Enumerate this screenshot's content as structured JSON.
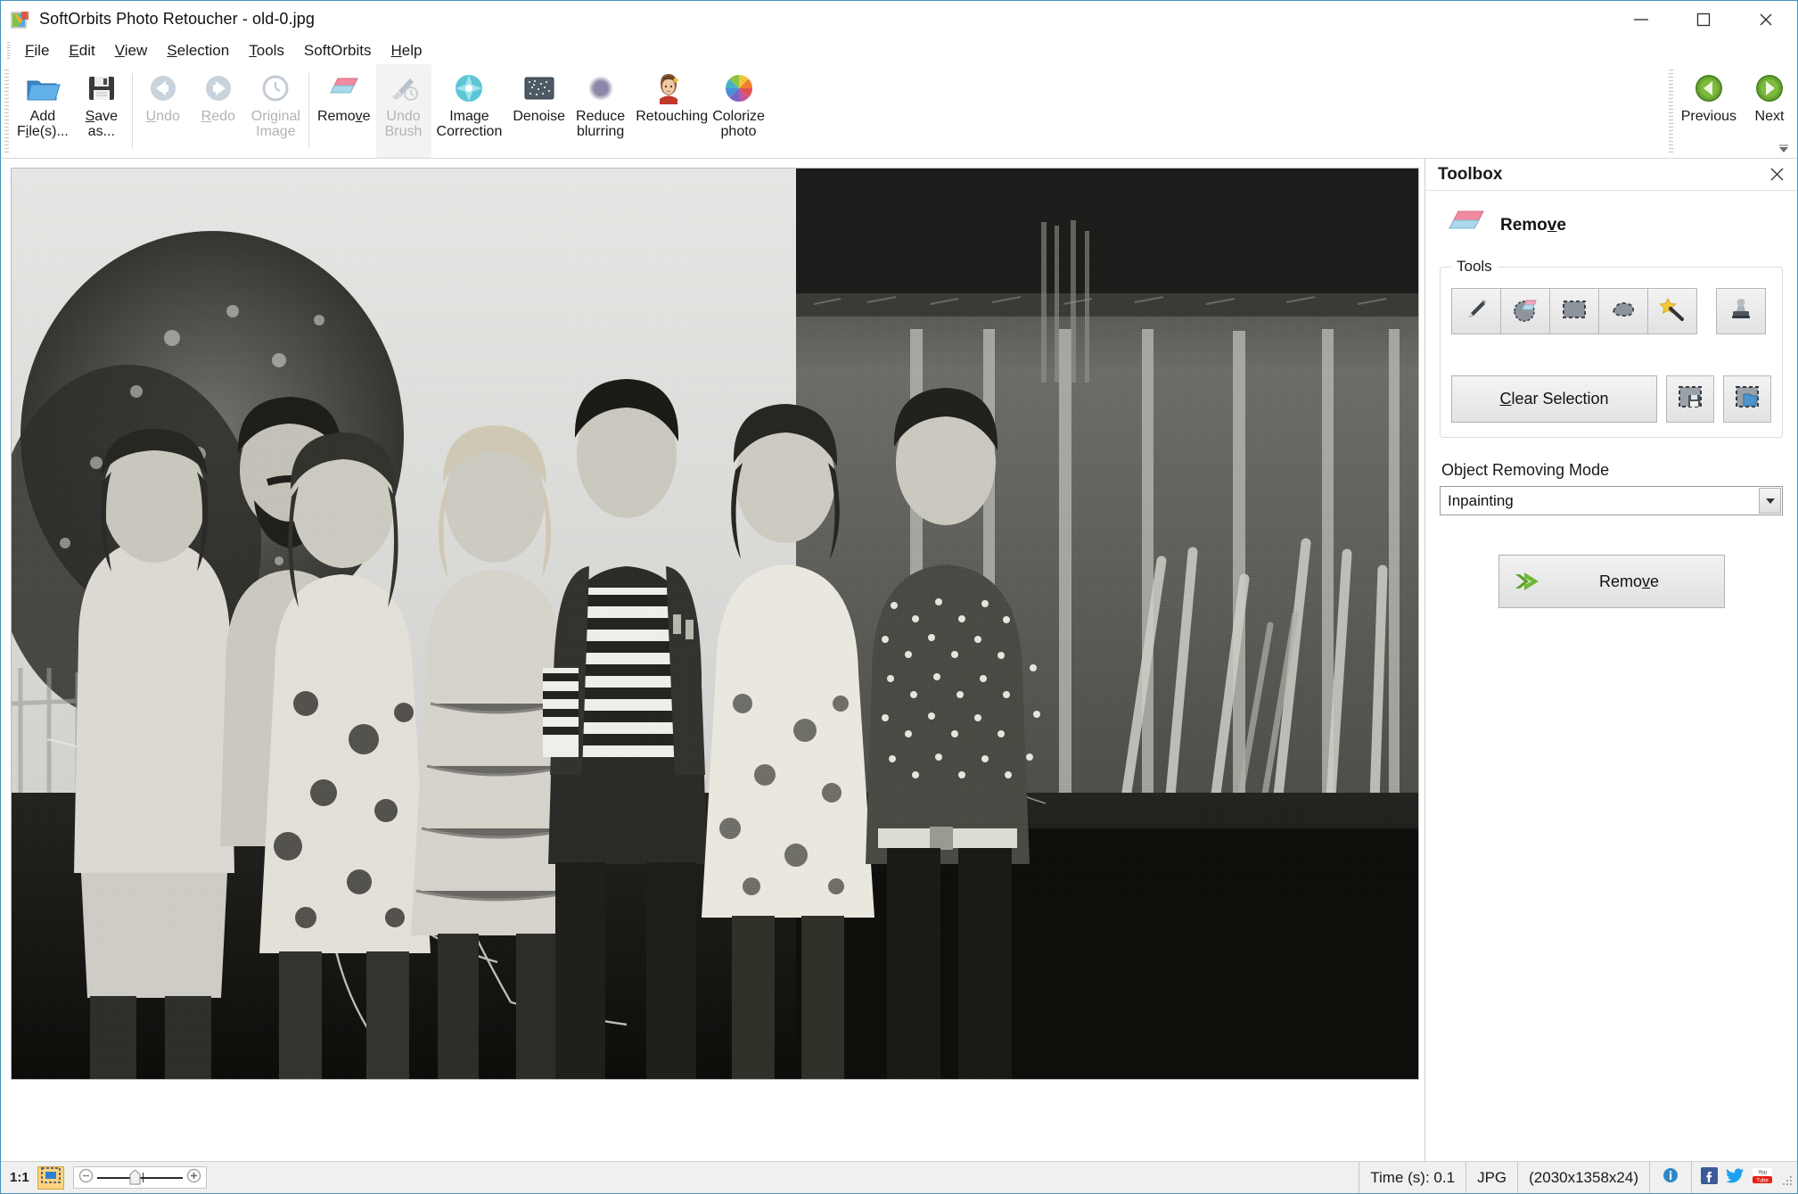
{
  "window": {
    "title": "SoftOrbits Photo Retoucher - old-0.jpg",
    "app_icon": "app-logo-icon",
    "minimize_label": "Minimize",
    "maximize_label": "Maximize",
    "close_label": "Close"
  },
  "menu": {
    "items": [
      {
        "label": "File",
        "accel": "F"
      },
      {
        "label": "Edit",
        "accel": "E"
      },
      {
        "label": "View",
        "accel": "V"
      },
      {
        "label": "Selection",
        "accel": "S"
      },
      {
        "label": "Tools",
        "accel": "T"
      },
      {
        "label": "SoftOrbits",
        "accel": ""
      },
      {
        "label": "Help",
        "accel": "H"
      }
    ]
  },
  "ribbon": {
    "buttons": [
      {
        "id": "add-files",
        "line1": "Add",
        "line2": "File(s)...",
        "icon": "open-folder-icon",
        "enabled": true,
        "accel": "F"
      },
      {
        "id": "save-as",
        "line1": "Save",
        "line2": "as...",
        "icon": "floppy-disk-icon",
        "enabled": true,
        "accel": "S"
      },
      {
        "id": "undo",
        "line1": "Undo",
        "line2": "",
        "icon": "arrow-left-circle-icon",
        "enabled": false,
        "accel": "U"
      },
      {
        "id": "redo",
        "line1": "Redo",
        "line2": "",
        "icon": "arrow-right-circle-icon",
        "enabled": false,
        "accel": "R"
      },
      {
        "id": "original-image",
        "line1": "Original",
        "line2": "Image",
        "icon": "clock-history-icon",
        "enabled": false,
        "accel": ""
      },
      {
        "id": "remove",
        "line1": "Remove",
        "line2": "",
        "icon": "eraser-icon",
        "enabled": true,
        "accel": "v"
      },
      {
        "id": "undo-brush",
        "line1": "Undo",
        "line2": "Brush",
        "icon": "brush-clock-icon",
        "enabled": false,
        "accel": ""
      },
      {
        "id": "image-correction",
        "line1": "Image",
        "line2": "Correction",
        "icon": "sparkle-star-icon",
        "enabled": true,
        "accel": ""
      },
      {
        "id": "denoise",
        "line1": "Denoise",
        "line2": "",
        "icon": "noise-square-icon",
        "enabled": true,
        "accel": ""
      },
      {
        "id": "reduce-blurring",
        "line1": "Reduce",
        "line2": "blurring",
        "icon": "blur-circle-icon",
        "enabled": true,
        "accel": ""
      },
      {
        "id": "retouching",
        "line1": "Retouching",
        "line2": "",
        "icon": "woman-face-icon",
        "enabled": true,
        "accel": ""
      },
      {
        "id": "colorize-photo",
        "line1": "Colorize",
        "line2": "photo",
        "icon": "color-wheel-icon",
        "enabled": true,
        "accel": ""
      }
    ],
    "navigation": [
      {
        "id": "previous",
        "label": "Previous",
        "icon": "green-left-arrow-icon",
        "enabled": true
      },
      {
        "id": "next",
        "label": "Next",
        "icon": "green-right-arrow-icon",
        "enabled": true
      }
    ],
    "expander_icon": "ribbon-expand-icon"
  },
  "toolbox": {
    "panel_title": "Toolbox",
    "close_icon": "close-icon",
    "mode_icon": "eraser-icon",
    "mode_name": "Remove",
    "mode_accel": "v",
    "tools_group_label": "Tools",
    "tools": [
      {
        "id": "pencil",
        "icon": "pencil-icon",
        "selected": false
      },
      {
        "id": "erase-select",
        "icon": "eraser-selection-icon",
        "selected": false
      },
      {
        "id": "rect-select",
        "icon": "rectangle-select-icon",
        "selected": false
      },
      {
        "id": "lasso-select",
        "icon": "lasso-select-icon",
        "selected": false
      },
      {
        "id": "magic-wand",
        "icon": "magic-wand-icon",
        "selected": false
      },
      {
        "id": "clone-stamp",
        "icon": "clone-stamp-icon",
        "selected": false
      }
    ],
    "clear_selection_label": "Clear Selection",
    "clear_selection_accel": "C",
    "selection_actions": [
      {
        "id": "save-selection",
        "icon": "save-selection-icon"
      },
      {
        "id": "load-selection",
        "icon": "load-selection-icon"
      }
    ],
    "mode_field_label": "Object Removing Mode",
    "mode_value": "Inpainting",
    "mode_options": [
      "Inpainting"
    ],
    "remove_button_label": "Remove",
    "remove_button_accel": "v",
    "remove_button_icon": "green-double-arrow-icon"
  },
  "statusbar": {
    "zoom_ratio": "1:1",
    "fit_icon": "fit-to-screen-icon",
    "zoom_out_icon": "zoom-out-icon",
    "zoom_in_icon": "zoom-in-icon",
    "time_label": "Time (s): 0.1",
    "format_label": "JPG",
    "dimensions_label": "(2030x1358x24)",
    "info_icon": "info-icon",
    "social": [
      {
        "id": "facebook",
        "icon": "facebook-icon"
      },
      {
        "id": "twitter",
        "icon": "twitter-icon"
      },
      {
        "id": "youtube",
        "icon": "youtube-icon"
      }
    ]
  },
  "colors": {
    "accent_green": "#5a9e2f",
    "accent_blue": "#4a90b8",
    "highlight_orange": "#ffd37f",
    "eraser_pink": "#f2899f",
    "eraser_blue": "#a9d9ea"
  }
}
